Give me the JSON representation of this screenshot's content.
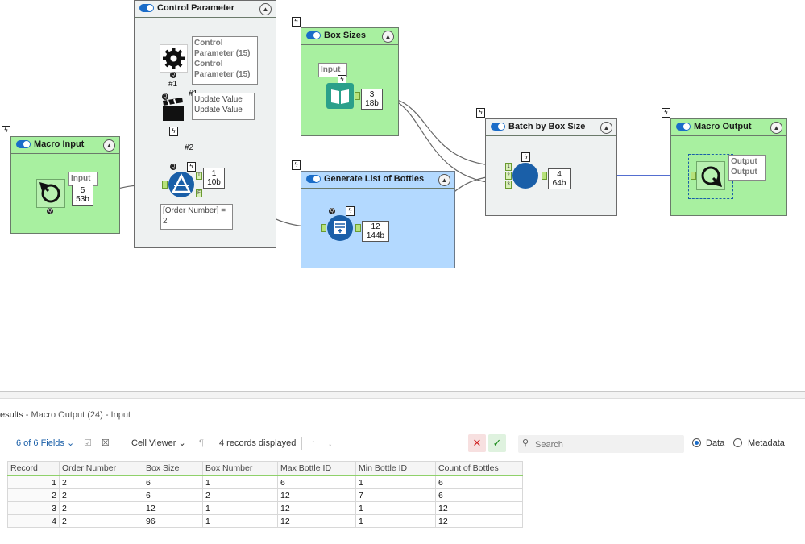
{
  "canvas": {
    "containers": {
      "control_parameter": {
        "title": "Control Parameter"
      },
      "macro_input": {
        "title": "Macro Input"
      },
      "box_sizes": {
        "title": "Box Sizes"
      },
      "generate_list": {
        "title": "Generate List of Bottles"
      },
      "batch": {
        "title": "Batch by Box Size"
      },
      "macro_output": {
        "title": "Macro Output"
      }
    },
    "notes": {
      "control_param": "Control Parameter (15) Control Parameter (15)",
      "update_value": "Update Value Update Value",
      "macro_input": "Input",
      "box_input": "Input",
      "filter": "[Order Number] = 2",
      "macro_output": "Output Output"
    },
    "labels": {
      "hash1": "#1",
      "hash1b": "#1",
      "hash2": "#2"
    },
    "badges": {
      "macro_input": {
        "count": "5",
        "size": "53b"
      },
      "filter": {
        "count": "1",
        "size": "10b"
      },
      "box_sizes": {
        "count": "3",
        "size": "18b"
      },
      "generate": {
        "count": "12",
        "size": "144b"
      },
      "batch": {
        "count": "4",
        "size": "64b"
      }
    },
    "anchor_letters": {
      "t": "T",
      "f": "F",
      "in1": "1",
      "in2": "2",
      "in3": "3"
    },
    "colors": {
      "green_container": "#a8f0a0",
      "blue_container": "#b3d9ff",
      "gray_container": "#eef1f1",
      "accent": "#1a6cc8",
      "wire_highlight": "#1a3fc0"
    }
  },
  "results": {
    "title_prefix": "esults",
    "title_suffix": " - Macro Output (24) - Input",
    "fields": "6 of 6 Fields",
    "viewer": "Cell Viewer",
    "records": "4 records displayed",
    "search_placeholder": "Search",
    "radio_data": "Data",
    "radio_metadata": "Metadata",
    "columns": [
      "Record",
      "Order Number",
      "Box Size",
      "Box Number",
      "Max Bottle ID",
      "Min Bottle ID",
      "Count of Bottles"
    ],
    "rows": [
      [
        "1",
        "2",
        "6",
        "1",
        "6",
        "1",
        "6"
      ],
      [
        "2",
        "2",
        "6",
        "2",
        "12",
        "7",
        "6"
      ],
      [
        "3",
        "2",
        "12",
        "1",
        "12",
        "1",
        "12"
      ],
      [
        "4",
        "2",
        "96",
        "1",
        "12",
        "1",
        "12"
      ]
    ]
  }
}
